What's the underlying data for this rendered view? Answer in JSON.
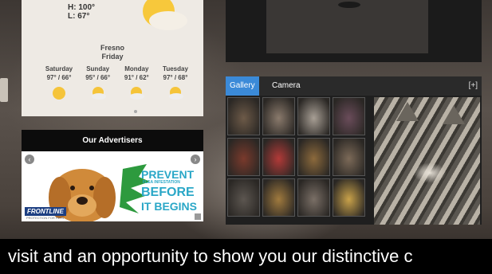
{
  "weather": {
    "current_hilo": [
      "H: 100°",
      "L: 67°"
    ],
    "city": "Fresno",
    "today": "Friday",
    "forecast": [
      {
        "day": "Saturday",
        "temps": "97° / 66°"
      },
      {
        "day": "Sunday",
        "temps": "95° / 66°"
      },
      {
        "day": "Monday",
        "temps": "91° / 62°"
      },
      {
        "day": "Tuesday",
        "temps": "97° / 68°"
      }
    ]
  },
  "advertisers": {
    "heading": "Our Advertisers",
    "prev": "‹",
    "next": "›",
    "ad": {
      "brand": "FRONTLINE",
      "brand_sub": "PROTECTION FOR PETS",
      "line1": "PREVENT",
      "line2": "FLEA INFESTATION",
      "line3": "BEFORE",
      "line4": "IT BEGINS"
    }
  },
  "gallery": {
    "tabs": [
      "Gallery",
      "Camera"
    ],
    "expand": "[+]",
    "thumb_colors": [
      "#6d5a48",
      "#8a7a6c",
      "#a89f95",
      "#6a4c5a",
      "#7a3a2c",
      "#b23a38",
      "#8c6a3c",
      "#7c6a58",
      "#5c5650",
      "#a07a3e",
      "#7a6f66",
      "#c9a24a"
    ]
  },
  "caption": "visit and an opportunity to show you our distinctive c"
}
